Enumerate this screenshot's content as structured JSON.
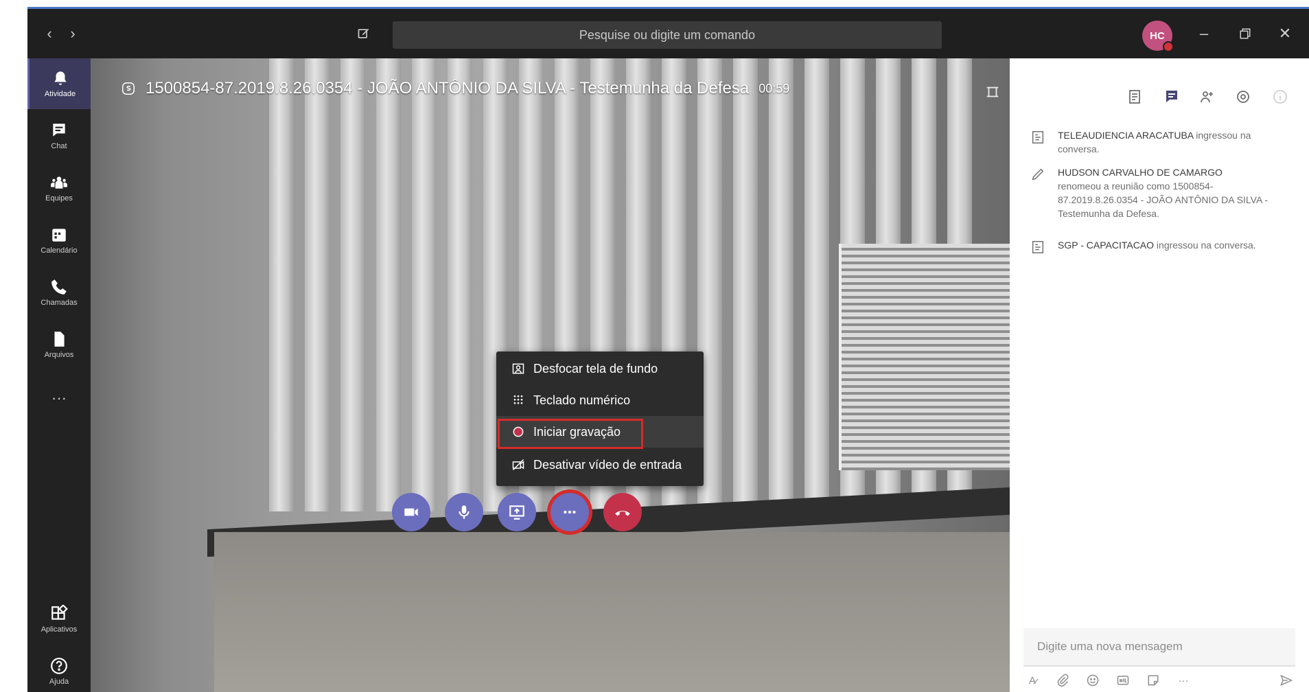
{
  "search": {
    "placeholder": "Pesquise ou digite um comando"
  },
  "avatar": {
    "initials": "HC"
  },
  "rail": {
    "items": [
      {
        "label": "Atividade",
        "icon": "bell-icon"
      },
      {
        "label": "Chat",
        "icon": "chat-icon"
      },
      {
        "label": "Equipes",
        "icon": "teams-icon"
      },
      {
        "label": "Calendário",
        "icon": "calendar-icon"
      },
      {
        "label": "Chamadas",
        "icon": "phone-icon"
      },
      {
        "label": "Arquivos",
        "icon": "file-icon"
      }
    ],
    "more": "···",
    "apps": "Aplicativos",
    "help": "Ajuda"
  },
  "meeting": {
    "title": "1500854-87.2019.8.26.0354 - JOÃO ANTÔNIO DA SILVA - Testemunha da Defesa",
    "timer": "00:59"
  },
  "menu": {
    "items": [
      {
        "label": "Desfocar tela de fundo",
        "icon": "blur-background-icon"
      },
      {
        "label": "Teclado numérico",
        "icon": "dialpad-icon"
      },
      {
        "label": "Iniciar gravação",
        "icon": "record-icon"
      },
      {
        "label": "Desativar vídeo de entrada",
        "icon": "video-off-icon"
      }
    ]
  },
  "controls": {
    "camera": "camera-icon",
    "mic": "microphone-icon",
    "share": "share-screen-icon",
    "more": "more-actions-icon",
    "hangup": "hang-up-icon"
  },
  "activity": {
    "messages": [
      {
        "who": "TELEAUDIENCIA ARACATUBA",
        "text": " ingressou na conversa."
      },
      {
        "who": "HUDSON CARVALHO DE CAMARGO",
        "text": "renomeou a reunião como 1500854-87.2019.8.26.0354 - JOÃO ANTÔNIO DA SILVA - Testemunha da Defesa."
      },
      {
        "who": "SGP - CAPACITACAO",
        "text": " ingressou na conversa."
      }
    ],
    "compose_placeholder": "Digite uma nova mensagem"
  },
  "colors": {
    "accent": "#6264a7",
    "hangup": "#c4314b",
    "highlight": "#d42b2b"
  }
}
